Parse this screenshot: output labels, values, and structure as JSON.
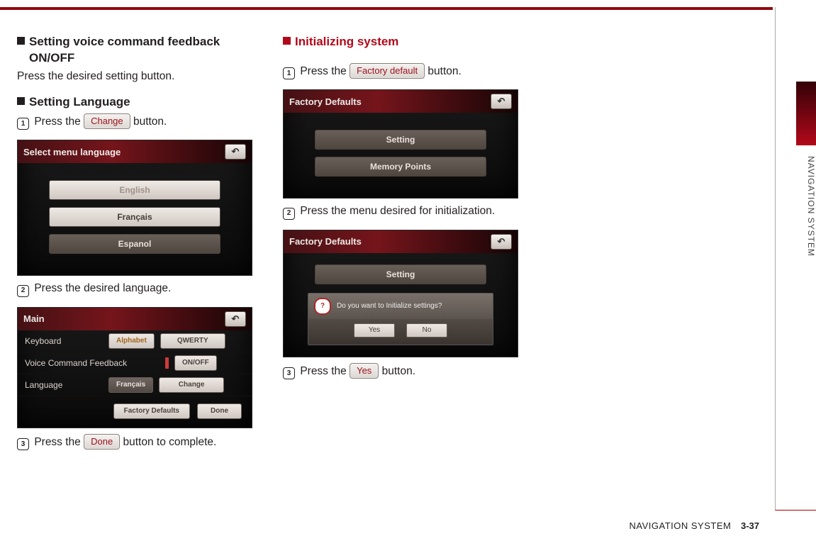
{
  "side": {
    "label": "NAVIGATION SYSTEM"
  },
  "footer": {
    "section": "NAVIGATION SYSTEM",
    "page": "3-37"
  },
  "col1": {
    "h1_line1": "Setting voice command feedback",
    "h1_line2": "ON/OFF",
    "p1": "Press the desired setting button.",
    "h2": "Setting Language",
    "s1_pre": "Press the ",
    "s1_btn": "Change",
    "s1_post": "  button.",
    "shot1": {
      "title": "Select menu language",
      "opt1": "English",
      "opt2": "Français",
      "opt3": "Espanol"
    },
    "s2": "Press the desired language.",
    "shot2": {
      "title": "Main",
      "row1_label": "Keyboard",
      "row1_sel": "Alphabet",
      "row1_alt": "QWERTY",
      "row2_label": "Voice Command Feedback",
      "row2_btn": "ON/OFF",
      "row3_label": "Language",
      "row3_val": "Français",
      "row3_btn": "Change",
      "foot1": "Factory Defaults",
      "foot2": "Done"
    },
    "s3_pre": "Press the ",
    "s3_btn": "Done",
    "s3_post": " button to complete."
  },
  "col2": {
    "h1": "Initializing system",
    "s1_pre": "Press the ",
    "s1_btn": "Factory default",
    "s1_post": "  button.",
    "shot1": {
      "title": "Factory Defaults",
      "opt1": "Setting",
      "opt2": "Memory Points"
    },
    "s2": "Press the menu desired for initialization.",
    "shot2": {
      "title": "Factory Defaults",
      "opt1": "Setting",
      "dlg_q": "Do you want to Initialize settings?",
      "dlg_yes": "Yes",
      "dlg_no": "No"
    },
    "s3_pre": "Press the ",
    "s3_btn": "Yes",
    "s3_post": " button."
  }
}
